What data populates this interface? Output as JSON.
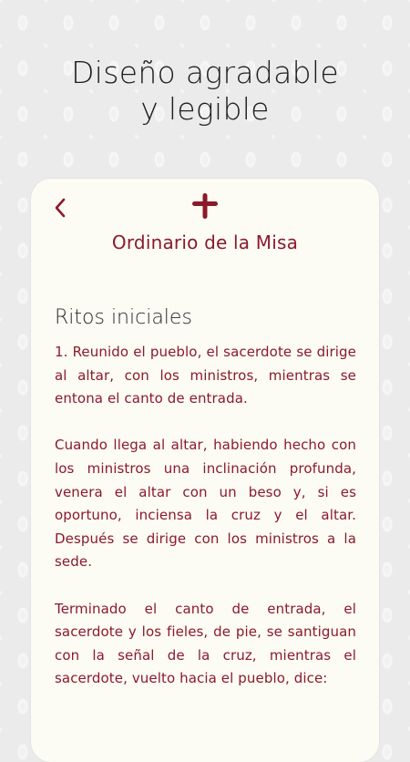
{
  "headline": {
    "line1": "Diseño agradable",
    "line2": "y legible"
  },
  "card": {
    "title": "Ordinario de la Misa",
    "section_heading": "Ritos iniciales",
    "paragraphs": [
      "1. Reunido el pueblo, el sacerdote se dirige al altar, con los ministros, mientras se entona el canto de entrada.",
      "Cuando llega al altar, habiendo hecho con los ministros una inclinación profunda, venera el altar con un beso y, si es oportuno, inciensa la cruz y el altar. Después se dirige con los ministros a la sede.",
      "Terminado el canto de entrada, el sacerdote y los fieles, de pie, se santiguan con la señal de la cruz, mientras el sacerdote, vuelto hacia el pueblo, dice:"
    ],
    "back_icon": "chevron-left-icon",
    "cross_icon": "cross-icon"
  },
  "colors": {
    "accent": "#8b1a2b",
    "card_background": "#fcfbf4",
    "page_background": "#ebebeb",
    "headline_text": "#1f1f1f"
  }
}
